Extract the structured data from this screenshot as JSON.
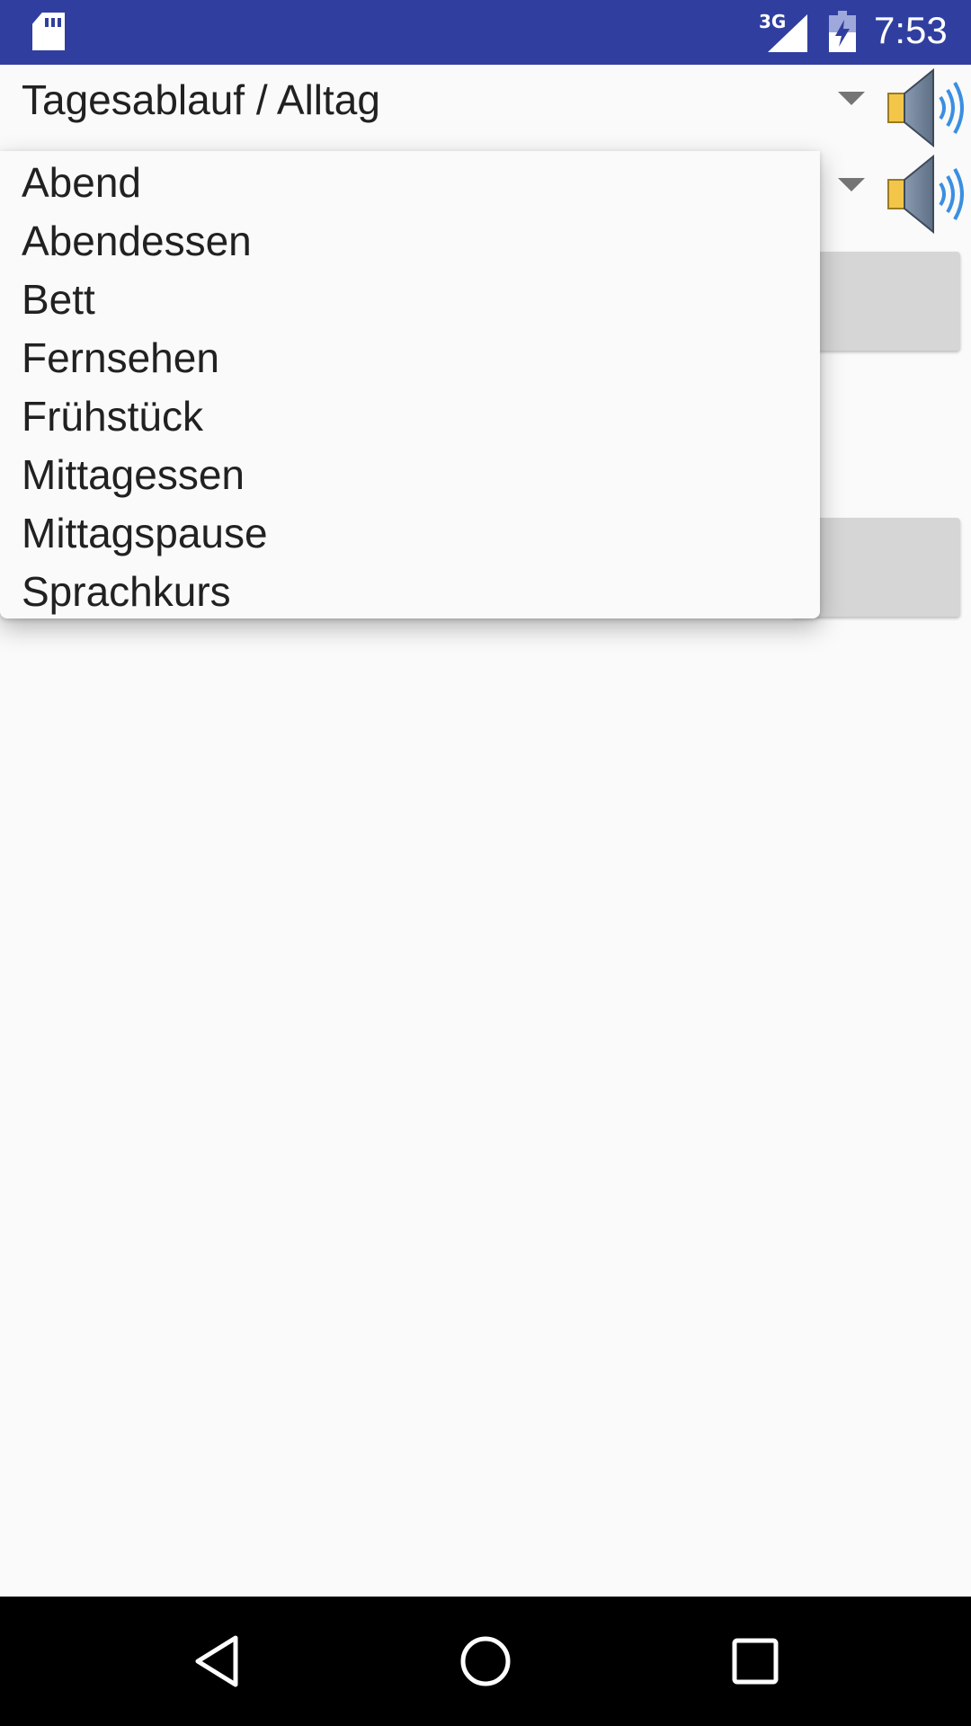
{
  "status_bar": {
    "network_type": "3G",
    "time": "7:53",
    "icons": [
      "sd-card-icon",
      "signal-icon",
      "battery-charging-icon"
    ],
    "color": "#303f9f"
  },
  "spinners": {
    "category": {
      "selected": "Tagesablauf / Alltag",
      "speaker_icon": "speaker-icon"
    },
    "word": {
      "selected": "",
      "speaker_icon": "speaker-icon"
    }
  },
  "dropdown": {
    "items": [
      "Abend",
      "Abendessen",
      "Bett",
      "Fernsehen",
      "Frühstück",
      "Mittagessen",
      "Mittagspause",
      "Sprachkurs"
    ]
  },
  "nav_bar": {
    "icons": [
      "back-icon",
      "home-icon",
      "recent-apps-icon"
    ]
  }
}
